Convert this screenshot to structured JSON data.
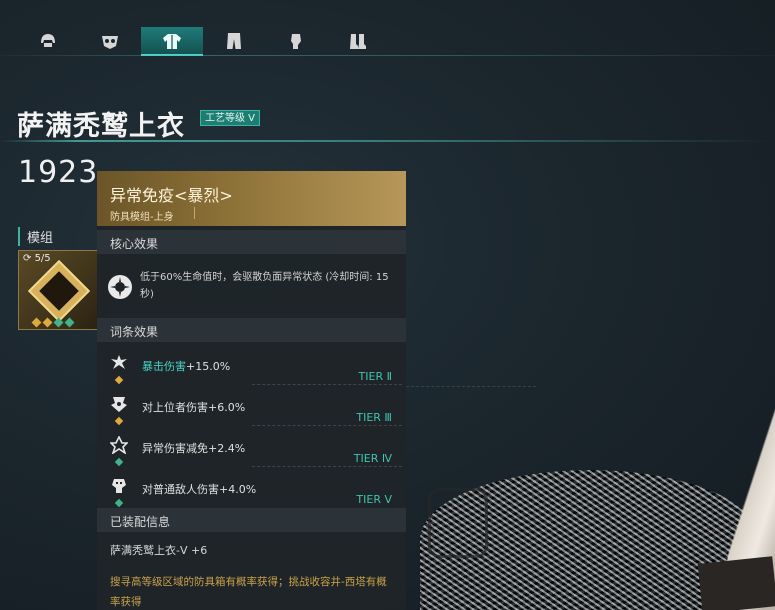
{
  "tabs": [
    {
      "icon": "helmet-icon",
      "active": false
    },
    {
      "icon": "mask-icon",
      "active": false
    },
    {
      "icon": "jacket-icon",
      "active": true
    },
    {
      "icon": "pants-icon",
      "active": false
    },
    {
      "icon": "glove-icon",
      "active": false
    },
    {
      "icon": "boots-icon",
      "active": false
    }
  ],
  "item": {
    "name": "萨满秃鹫上衣",
    "craft_badge": "工艺等级 V",
    "stat_value": "1923"
  },
  "module": {
    "label": "模组",
    "count": "5/5"
  },
  "popup": {
    "title": "异常免疫<暴烈>",
    "subtitle": "防具模组-上身",
    "core_header": "核心效果",
    "core_text": "低于60%生命值时，会驱散负面异常状态 (冷却时间: 15秒)",
    "affix_header": "词条效果",
    "affixes": [
      {
        "name": "暴击伤害",
        "value": "+15.0%",
        "tier": "TIER Ⅱ",
        "highlight": true,
        "gem_color": "#e0a93b"
      },
      {
        "name": "对上位者伤害",
        "value": "+6.0%",
        "tier": "TIER Ⅲ",
        "highlight": false,
        "gem_color": "#e0a93b"
      },
      {
        "name": "异常伤害减免",
        "value": "+2.4%",
        "tier": "TIER Ⅳ",
        "highlight": false,
        "gem_color": "#3fb38a"
      },
      {
        "name": "对普通敌人伤害",
        "value": "+4.0%",
        "tier": "TIER Ⅴ",
        "highlight": false,
        "gem_color": "#3fb38a"
      }
    ],
    "equip_header": "已装配信息",
    "equip_text": "萨满秃鹫上衣-Ⅴ +6",
    "source_text": "搜寻高等级区域的防具箱有概率获得；挑战收容井-西塔有概率获得"
  },
  "colors": {
    "accent": "#3fb3a3",
    "gold": "#c9a24b",
    "tier": "#3fc4ad"
  }
}
